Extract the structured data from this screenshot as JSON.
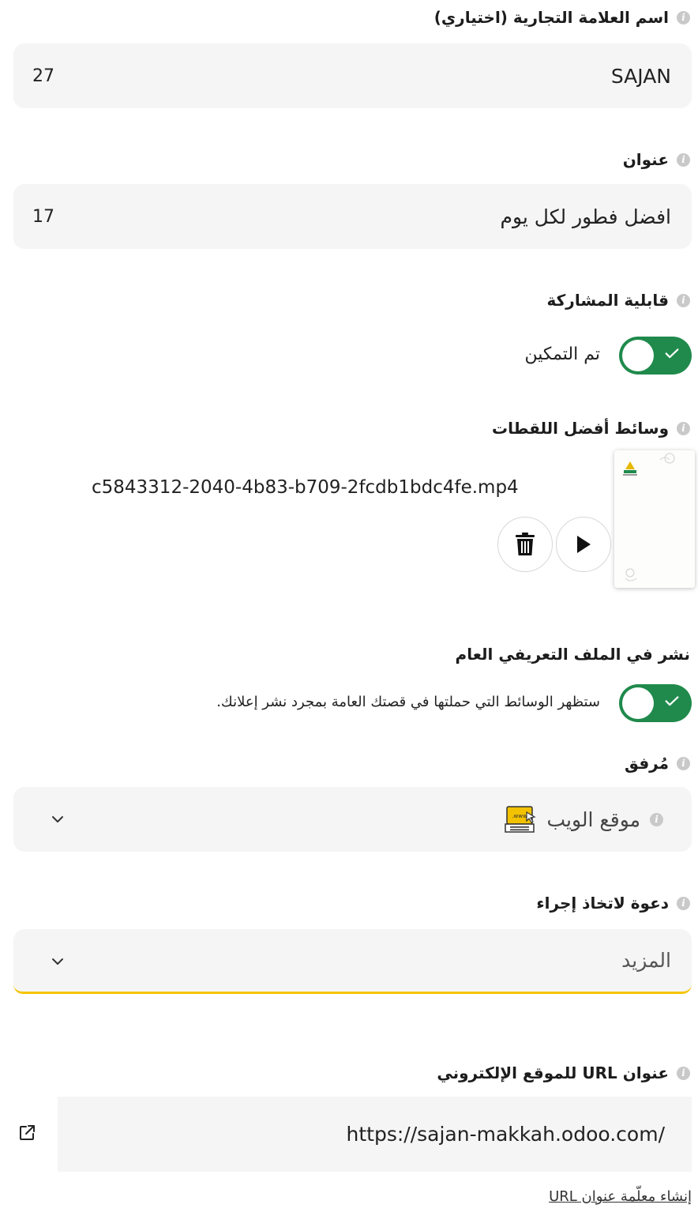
{
  "brand_name": {
    "label": "اسم العلامة التجارية (اختياري)",
    "value": "SAJAN",
    "remaining_chars": "27"
  },
  "headline": {
    "label": "عنوان",
    "value": "افضل فطور لكل يوم",
    "remaining_chars": "17"
  },
  "shareability": {
    "label": "قابلية المشاركة",
    "toggle_on": true,
    "status_text": "تم التمكين"
  },
  "highlight_media": {
    "label": "وسائط أفضل اللقطات",
    "file_name": "c5843312-2040-4b83-b709-2fcdb1bdc4fe.mp4",
    "delete_icon": "trash-icon",
    "play_icon": "play-icon"
  },
  "public_profile": {
    "label": "نشر في الملف التعريفي العام",
    "toggle_on": true,
    "description": "ستظهر الوسائط التي حملتها في قصتك العامة بمجرد نشر إعلانك."
  },
  "attachment": {
    "label": "مُرفق",
    "selected": "موقع الويب",
    "icon": "website-icon"
  },
  "call_to_action": {
    "label": "دعوة لاتخاذ إجراء",
    "selected": "المزيد"
  },
  "website_url": {
    "label": "عنوان URL للموقع الإلكتروني",
    "value": "https://sajan-makkah.odoo.com/",
    "open_icon": "external-link-icon",
    "template_link": "إنشاء معلّمة عنوان URL"
  },
  "colors": {
    "toggle_green": "#1f8a4c",
    "focus_yellow": "#f5c400",
    "field_bg": "#f5f5f5"
  }
}
